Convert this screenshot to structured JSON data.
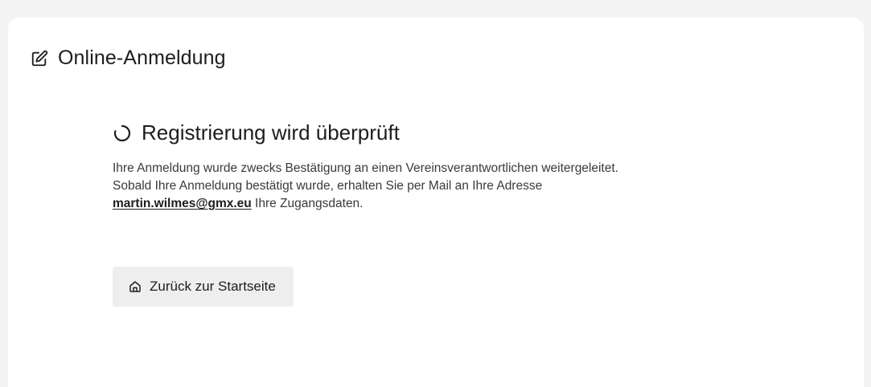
{
  "header": {
    "icon": "edit-icon",
    "title": "Online-Anmeldung"
  },
  "status": {
    "icon": "spinner-icon",
    "title": "Registrierung wird überprüft",
    "line1": "Ihre Anmeldung wurde zwecks Bestätigung an einen Vereinsverantwortlichen weitergeleitet.",
    "line2": "Sobald Ihre Anmeldung bestätigt wurde, erhalten Sie per Mail an Ihre Adresse",
    "email": "martin.wilmes@gmx.eu",
    "line3_suffix": " Ihre Zugangsdaten."
  },
  "actions": {
    "home_icon": "home-icon",
    "home_label": "Zurück zur Startseite"
  },
  "colors": {
    "background": "#f4f4f5",
    "card": "#ffffff",
    "button_bg": "#eeeeef",
    "text": "#1d1d1f"
  }
}
